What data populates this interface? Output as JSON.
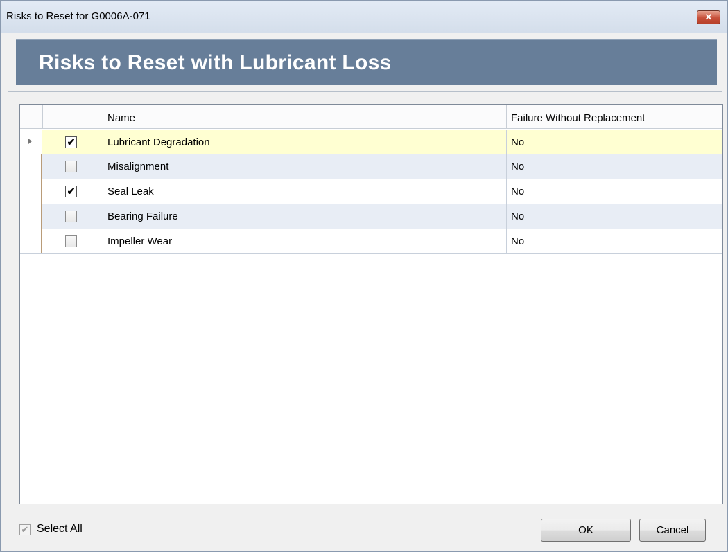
{
  "window": {
    "title": "Risks to Reset for G0006A-071",
    "close_glyph": "✕"
  },
  "header": {
    "title": "Risks to Reset with Lubricant Loss"
  },
  "grid": {
    "columns": {
      "name": "Name",
      "failure_without_replacement": "Failure Without Replacement"
    },
    "rows": [
      {
        "checked": true,
        "check_glyph": "✔",
        "name": "Lubricant Degradation",
        "failure_without_replacement": "No"
      },
      {
        "checked": false,
        "check_glyph": "",
        "name": "Misalignment",
        "failure_without_replacement": "No"
      },
      {
        "checked": true,
        "check_glyph": "✔",
        "name": "Seal Leak",
        "failure_without_replacement": "No"
      },
      {
        "checked": false,
        "check_glyph": "",
        "name": "Bearing Failure",
        "failure_without_replacement": "No"
      },
      {
        "checked": false,
        "check_glyph": "",
        "name": "Impeller Wear",
        "failure_without_replacement": "No"
      }
    ]
  },
  "footer": {
    "select_all_label": "Select All",
    "select_all_checked": true,
    "select_all_glyph": "✔",
    "ok_label": "OK",
    "cancel_label": "Cancel"
  },
  "colors": {
    "banner": "#677e99",
    "active_row": "#ffffd2",
    "alt_row": "#e8edf5"
  }
}
